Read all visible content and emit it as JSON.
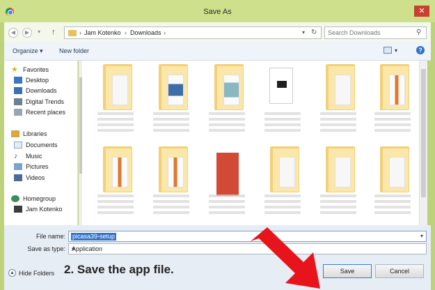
{
  "window": {
    "title": "Save As",
    "close_glyph": "✕"
  },
  "address": {
    "crumbs": [
      "Jam Kotenko",
      "Downloads"
    ],
    "search_placeholder": "Search Downloads"
  },
  "toolbar": {
    "organize": "Organize ▾",
    "new_folder": "New folder"
  },
  "sidebar": {
    "favorites": "Favorites",
    "desktop": "Desktop",
    "downloads": "Downloads",
    "digital_trends": "Digital Trends",
    "recent_places": "Recent places",
    "libraries": "Libraries",
    "documents": "Documents",
    "music": "Music",
    "pictures": "Pictures",
    "videos": "Videos",
    "homegroup": "Homegroup",
    "jam_kotenko": "Jam Kotenko"
  },
  "form": {
    "file_name_label": "File name:",
    "file_name_value": "picasa39-setup",
    "save_as_type_label": "Save as type:",
    "save_as_type_value": "Application"
  },
  "footer": {
    "hide_folders": "Hide Folders",
    "save": "Save",
    "cancel": "Cancel"
  },
  "instruction": "2. Save the app file.",
  "colors": {
    "arrow": "#e8141b",
    "accent": "#3374c9",
    "frame": "#bdd27a"
  },
  "icons": [
    "chrome-app-icon",
    "back-icon",
    "forward-icon",
    "up-arrow-icon",
    "folder-icon",
    "refresh-icon",
    "search-icon",
    "view-icon",
    "help-icon",
    "star-icon",
    "desktop-icon",
    "downloads-icon",
    "libraries-icon",
    "documents-icon",
    "music-icon",
    "pictures-icon",
    "videos-icon",
    "homegroup-icon",
    "user-icon",
    "hide-folders-icon",
    "red-arrow"
  ]
}
